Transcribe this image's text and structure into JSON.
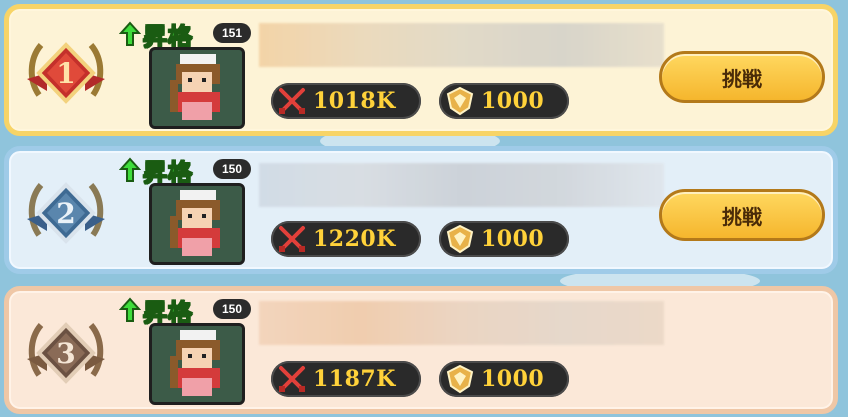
{
  "promotion_label": "昇格",
  "challenge_label": "挑戦",
  "rows": [
    {
      "rank": "1",
      "level": "151",
      "power": "1018K",
      "medals": "1000",
      "has_challenge": true
    },
    {
      "rank": "2",
      "level": "150",
      "power": "1220K",
      "medals": "1000",
      "has_challenge": true
    },
    {
      "rank": "3",
      "level": "150",
      "power": "1187K",
      "medals": "1000",
      "has_challenge": false
    }
  ],
  "colors": {
    "rank1_frame": "#f7d467",
    "rank2_frame": "#9fcbe8",
    "rank3_frame": "#efc7a6",
    "value_text": "#ffd23a",
    "promotion_text": "#3fdc3b",
    "button_fill": "#f5b62d"
  },
  "icons": {
    "power": "crossed-swords-icon",
    "medals": "shield-medal-icon",
    "promotion": "up-arrow-icon",
    "rank": "laurel-wreath-badge-icon"
  }
}
